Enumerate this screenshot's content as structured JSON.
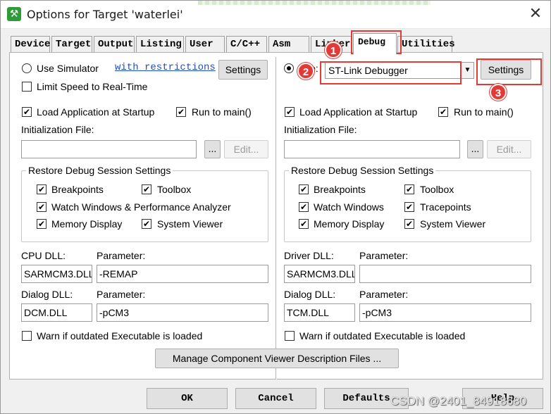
{
  "window": {
    "title": "Options for Target 'waterlei'",
    "close_glyph": "✕",
    "icon": "keil-icon"
  },
  "tabs": [
    {
      "label": "Device"
    },
    {
      "label": "Target"
    },
    {
      "label": "Output"
    },
    {
      "label": "Listing"
    },
    {
      "label": "User"
    },
    {
      "label": "C/C++"
    },
    {
      "label": "Asm"
    },
    {
      "label": "Linker"
    },
    {
      "label": "Debug"
    },
    {
      "label": "Utilities"
    }
  ],
  "active_tab": "Debug",
  "left": {
    "use_simulator": "Use Simulator",
    "with_restrictions": "with restrictions",
    "settings_label": "Settings",
    "limit_speed": "Limit Speed to Real-Time",
    "load_app": "Load Application at Startup",
    "run_to_main": "Run to main()",
    "init_file_label": "Initialization File:",
    "init_file_value": "",
    "browse_label": "...",
    "edit_label": "Edit...",
    "restore_title": "Restore Debug Session Settings",
    "breakpoints": "Breakpoints",
    "toolbox": "Toolbox",
    "watch_windows": "Watch Windows & Performance Analyzer",
    "memory_display": "Memory Display",
    "system_viewer": "System Viewer",
    "cpu_dll_label": "CPU DLL:",
    "cpu_dll_value": "SARMCM3.DLL",
    "param_label": "Parameter:",
    "cpu_param_value": "-REMAP",
    "dialog_dll_label": "Dialog DLL:",
    "dialog_dll_value": "DCM.DLL",
    "dialog_param_value": "-pCM3",
    "warn_outdated": "Warn if outdated Executable is loaded"
  },
  "right": {
    "use_label": "Use:",
    "debugger_value": "ST-Link Debugger",
    "settings_label": "Settings",
    "load_app": "Load Application at Startup",
    "run_to_main": "Run to main()",
    "init_file_label": "Initialization File:",
    "init_file_value": "",
    "browse_label": "...",
    "edit_label": "Edit...",
    "restore_title": "Restore Debug Session Settings",
    "breakpoints": "Breakpoints",
    "toolbox": "Toolbox",
    "watch_windows": "Watch Windows",
    "tracepoints": "Tracepoints",
    "memory_display": "Memory Display",
    "system_viewer": "System Viewer",
    "driver_dll_label": "Driver DLL:",
    "driver_dll_value": "SARMCM3.DLL",
    "param_label": "Parameter:",
    "driver_param_value": "",
    "dialog_dll_label": "Dialog DLL:",
    "dialog_dll_value": "TCM.DLL",
    "dialog_param_value": "-pCM3",
    "warn_outdated": "Warn if outdated Executable is loaded"
  },
  "manage_button": "Manage Component Viewer Description Files ...",
  "footer": {
    "ok": "OK",
    "cancel": "Cancel",
    "defaults": "Defaults",
    "help": "Help"
  },
  "annotations": {
    "marker1": "1",
    "marker2": "2",
    "marker3": "3",
    "color": "#e53935"
  },
  "watermark": "CSDN @2401_84918680",
  "check_glyph": "✔"
}
